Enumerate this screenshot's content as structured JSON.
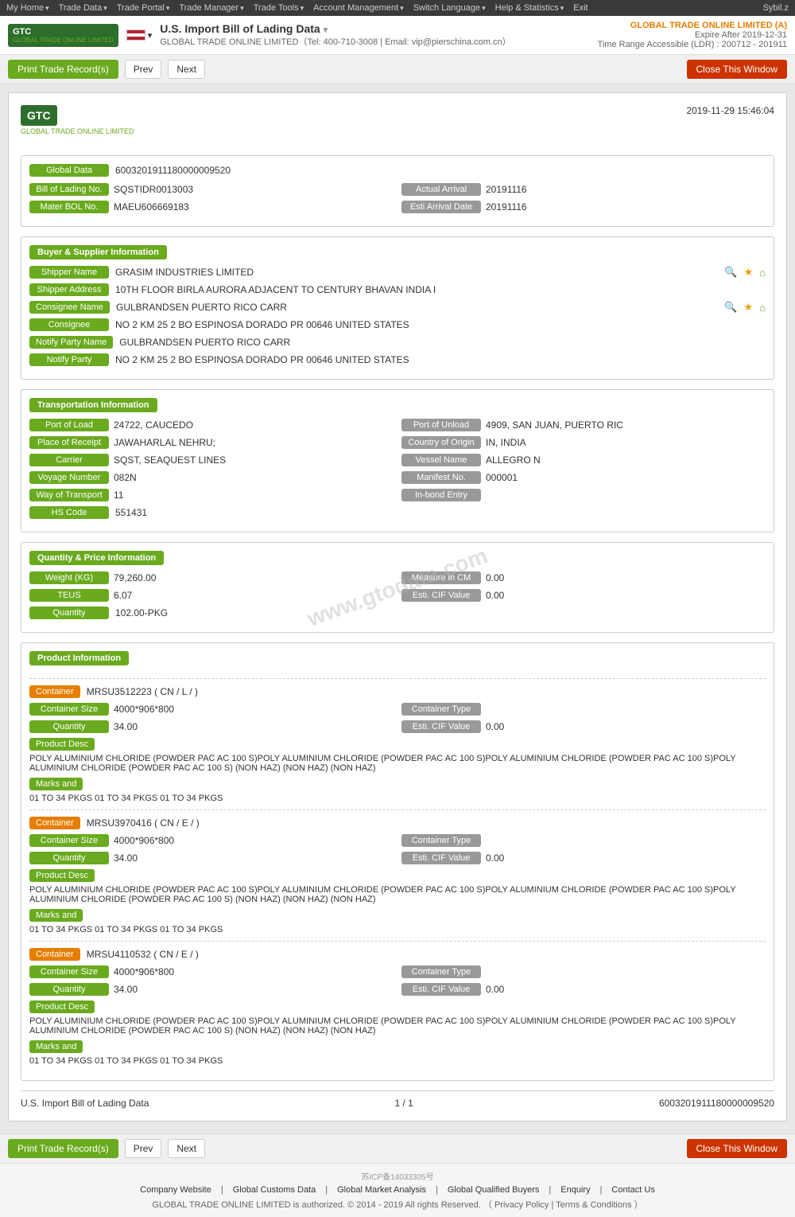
{
  "nav": {
    "items": [
      "My Home",
      "Trade Data",
      "Trade Portal",
      "Trade Manager",
      "Trade Tools",
      "Account Management",
      "Switch Language",
      "Help & Statistics",
      "Exit"
    ],
    "user": "Sybil.z"
  },
  "header": {
    "title": "U.S. Import Bill of Lading Data",
    "subtitle": "GLOBAL TRADE ONLINE LIMITED（Tel: 400-710-3008 | Email: vip@pierschina.com.cn）",
    "account": "GLOBAL TRADE ONLINE LIMITED (A)",
    "expire": "Expire After 2019-12-31",
    "timeRange": "Time Range Accessible (LDR) : 200712 - 201911"
  },
  "toolbar": {
    "print": "Print Trade Record(s)",
    "prev": "Prev",
    "next": "Next",
    "close": "Close This Window"
  },
  "document": {
    "timestamp": "2019-11-29 15:46:04",
    "globalData": {
      "label": "Global Data",
      "value": "6003201911180000009520"
    },
    "billOfLading": {
      "label": "Bill of Lading No.",
      "value": "SQSTIDR0013003",
      "actualArrivalLabel": "Actual Arrival",
      "actualArrivalValue": "20191116"
    },
    "masterBOL": {
      "label": "Mater BOL No.",
      "value": "MAEU606669183",
      "estiArrivalLabel": "Esti Arrival Date",
      "estiArrivalValue": "20191116"
    },
    "buyerSupplier": {
      "sectionLabel": "Buyer & Supplier Information",
      "shipperNameLabel": "Shipper Name",
      "shipperNameValue": "GRASIM INDUSTRIES LIMITED",
      "shipperAddressLabel": "Shipper Address",
      "shipperAddressValue": "10TH FLOOR BIRLA AURORA ADJACENT TO CENTURY BHAVAN INDIA I",
      "consigneeNameLabel": "Consignee Name",
      "consigneeNameValue": "GULBRANDSEN PUERTO RICO CARR",
      "consigneeLabel": "Consignee",
      "consigneeValue": "NO 2 KM 25 2 BO ESPINOSA DORADO PR 00646 UNITED STATES",
      "notifyPartyNameLabel": "Notify Party Name",
      "notifyPartyNameValue": "GULBRANDSEN PUERTO RICO CARR",
      "notifyPartyLabel": "Notify Party",
      "notifyPartyValue": "NO 2 KM 25 2 BO ESPINOSA DORADO PR 00646 UNITED STATES"
    },
    "transportation": {
      "sectionLabel": "Transportation Information",
      "portOfLoadLabel": "Port of Load",
      "portOfLoadValue": "24722, CAUCEDO",
      "portOfUnloadLabel": "Port of Unload",
      "portOfUnloadValue": "4909, SAN JUAN, PUERTO RIC",
      "placeOfReceiptLabel": "Place of Receipt",
      "placeOfReceiptValue": "JAWAHARLAL NEHRU;",
      "countryOfOriginLabel": "Country of Origin",
      "countryOfOriginValue": "IN, INDIA",
      "carrierLabel": "Carrier",
      "carrierValue": "SQST, SEAQUEST LINES",
      "vesselNameLabel": "Vessel Name",
      "vesselNameValue": "ALLEGRO N",
      "voyageNumberLabel": "Voyage Number",
      "voyageNumberValue": "082N",
      "manifestNoLabel": "Manifest No.",
      "manifestNoValue": "000001",
      "wayOfTransportLabel": "Way of Transport",
      "wayOfTransportValue": "11",
      "inBondEntryLabel": "In-bond Entry",
      "inBondEntryValue": "",
      "hsCodeLabel": "HS Code",
      "hsCodeValue": "551431"
    },
    "quantity": {
      "sectionLabel": "Quantity & Price Information",
      "weightLabel": "Weight (KG)",
      "weightValue": "79,260.00",
      "measureInCMLabel": "Measure in CM",
      "measureInCMValue": "0.00",
      "teusLabel": "TEUS",
      "teusValue": "6.07",
      "estiCIFLabel": "Esti. CIF Value",
      "estiCIFValue": "0.00",
      "quantityLabel": "Quantity",
      "quantityValue": "102.00-PKG"
    },
    "product": {
      "sectionLabel": "Product Information",
      "containers": [
        {
          "id": "MRSU3512223",
          "suffix": "( CN / L / )",
          "sizeLabel": "Container Size",
          "sizeValue": "4000*906*800",
          "typeLabel": "Container Type",
          "typeValue": "",
          "quantityLabel": "Quantity",
          "quantityValue": "34.00",
          "estiCIFLabel": "Esti. CIF Value",
          "estiCIFValue": "0.00",
          "productDescLabel": "Product Desc",
          "productDescValue": "POLY ALUMINIUM CHLORIDE (POWDER PAC AC 100 S)POLY ALUMINIUM CHLORIDE (POWDER PAC AC 100 S)POLY ALUMINIUM CHLORIDE (POWDER PAC AC 100 S)POLY ALUMINIUM CHLORIDE (POWDER PAC AC 100 S) (NON HAZ) (NON HAZ) (NON HAZ)",
          "marksLabel": "Marks and",
          "marksValue": "01 TO 34 PKGS 01 TO 34 PKGS 01 TO 34 PKGS"
        },
        {
          "id": "MRSU3970416",
          "suffix": "( CN / E / )",
          "sizeLabel": "Container Size",
          "sizeValue": "4000*906*800",
          "typeLabel": "Container Type",
          "typeValue": "",
          "quantityLabel": "Quantity",
          "quantityValue": "34.00",
          "estiCIFLabel": "Esti. CIF Value",
          "estiCIFValue": "0.00",
          "productDescLabel": "Product Desc",
          "productDescValue": "POLY ALUMINIUM CHLORIDE (POWDER PAC AC 100 S)POLY ALUMINIUM CHLORIDE (POWDER PAC AC 100 S)POLY ALUMINIUM CHLORIDE (POWDER PAC AC 100 S)POLY ALUMINIUM CHLORIDE (POWDER PAC AC 100 S) (NON HAZ) (NON HAZ) (NON HAZ)",
          "marksLabel": "Marks and",
          "marksValue": "01 TO 34 PKGS 01 TO 34 PKGS 01 TO 34 PKGS"
        },
        {
          "id": "MRSU4110532",
          "suffix": "( CN / E / )",
          "sizeLabel": "Container Size",
          "sizeValue": "4000*906*800",
          "typeLabel": "Container Type",
          "typeValue": "",
          "quantityLabel": "Quantity",
          "quantityValue": "34.00",
          "estiCIFLabel": "Esti. CIF Value",
          "estiCIFValue": "0.00",
          "productDescLabel": "Product Desc",
          "productDescValue": "POLY ALUMINIUM CHLORIDE (POWDER PAC AC 100 S)POLY ALUMINIUM CHLORIDE (POWDER PAC AC 100 S)POLY ALUMINIUM CHLORIDE (POWDER PAC AC 100 S)POLY ALUMINIUM CHLORIDE (POWDER PAC AC 100 S) (NON HAZ) (NON HAZ) (NON HAZ)",
          "marksLabel": "Marks and",
          "marksValue": "01 TO 34 PKGS 01 TO 34 PKGS 01 TO 34 PKGS"
        }
      ]
    },
    "docFooter": {
      "label": "U.S. Import Bill of Lading Data",
      "page": "1 / 1",
      "recordId": "6003201911180000009520"
    },
    "watermark": "www.gtodata.com"
  },
  "footer": {
    "icp": "苏ICP备14033305号",
    "links": [
      "Company Website",
      "Global Customs Data",
      "Global Market Analysis",
      "Global Qualified Buyers",
      "Enquiry",
      "Contact Us"
    ],
    "copyright": "GLOBAL TRADE ONLINE LIMITED is authorized. © 2014 - 2019 All rights Reserved.  （ Privacy Policy | Terms & Conditions ）"
  }
}
